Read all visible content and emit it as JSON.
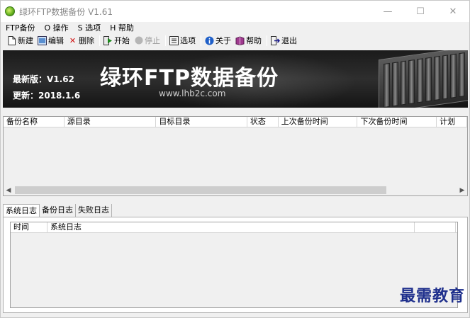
{
  "window": {
    "title": "绿环FTP数据备份 V1.61",
    "controls": [
      "—",
      "☐",
      "✕"
    ]
  },
  "menu": [
    {
      "label": "FTP备份",
      "accel": "F"
    },
    {
      "label": "O 操作",
      "accel": "O"
    },
    {
      "label": "S 选项",
      "accel": "S"
    },
    {
      "label": "H 帮助",
      "accel": "H"
    }
  ],
  "toolbar": {
    "new": "新建",
    "edit": "编辑",
    "delete": "删除",
    "start": "开始",
    "stop": "停止",
    "options": "选项",
    "about": "关于",
    "help": "帮助",
    "exit": "退出"
  },
  "banner": {
    "version": "最新版：V1.62",
    "updated": "更新：2018.1.6",
    "title": "绿环FTP数据备份",
    "url": "www.lhb2c.com"
  },
  "backup_list": {
    "columns": [
      "备份名称",
      "源目录",
      "目标目录",
      "状态",
      "上次备份时间",
      "下次备份时间",
      "计划"
    ],
    "rows": []
  },
  "tabs": [
    "系统日志",
    "备份日志",
    "失败日志"
  ],
  "log_view": {
    "columns": [
      "时间",
      "系统日志"
    ],
    "rows": []
  },
  "watermark": "最需教育",
  "colors": {
    "banner_bg": "#1b1b1b",
    "watermark": "#1e2f8c",
    "scroll_thumb": "#cdcdcd"
  }
}
